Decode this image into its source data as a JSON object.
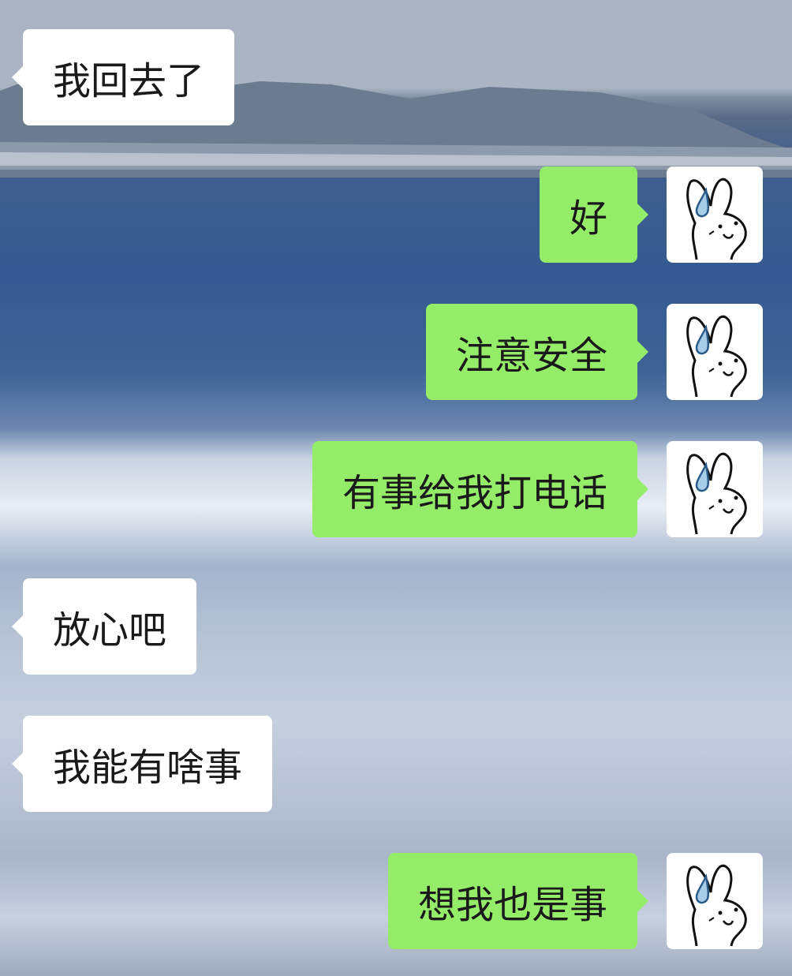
{
  "messages": [
    {
      "side": "left",
      "text": "我回去了"
    },
    {
      "side": "right",
      "text": "好",
      "avatar": "bunny-sweat-drop-icon"
    },
    {
      "side": "right",
      "text": "注意安全",
      "avatar": "bunny-sweat-drop-icon"
    },
    {
      "side": "right",
      "text": "有事给我打电话",
      "avatar": "bunny-sweat-drop-icon"
    },
    {
      "side": "left",
      "text": "放心吧"
    },
    {
      "side": "left",
      "text": "我能有啥事"
    },
    {
      "side": "right",
      "text": "想我也是事",
      "avatar": "bunny-sweat-drop-icon"
    }
  ],
  "colors": {
    "incoming_bubble": "#ffffff",
    "outgoing_bubble": "#95ec69",
    "text": "#1a1a1a"
  }
}
